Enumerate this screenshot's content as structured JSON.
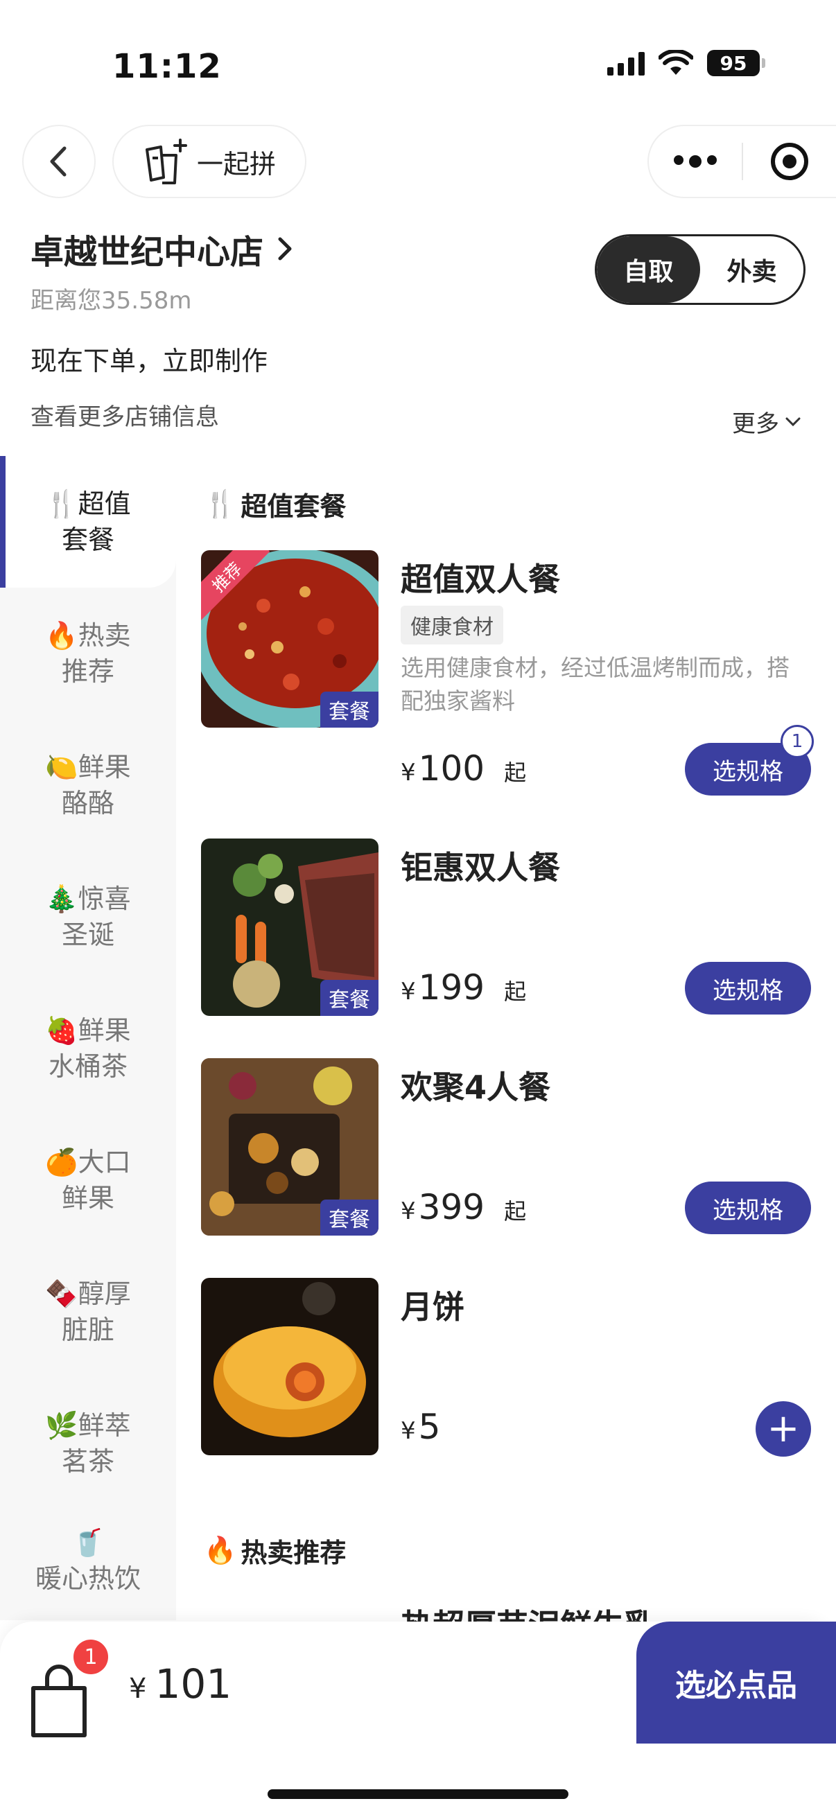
{
  "status": {
    "time": "11:12",
    "battery": "95"
  },
  "nav": {
    "together_label": "一起拼"
  },
  "store": {
    "name": "卓越世纪中心店",
    "distance": "距离您35.58m",
    "order_note": "现在下单，立即制作",
    "more_info": "查看更多店铺信息",
    "more_link": "更多",
    "mode_pickup": "自取",
    "mode_delivery": "外卖",
    "mode_selected": "自取"
  },
  "sidebar": {
    "items": [
      {
        "emoji": "🍴",
        "line1": "超值",
        "line2": "套餐",
        "active": true
      },
      {
        "emoji": "🔥",
        "line1": "热卖",
        "line2": "推荐"
      },
      {
        "emoji": "🍋",
        "line1": "鲜果",
        "line2": "酪酪"
      },
      {
        "emoji": "🎄",
        "line1": "惊喜",
        "line2": "圣诞"
      },
      {
        "emoji": "🍓",
        "line1": "鲜果",
        "line2": "水桶茶"
      },
      {
        "emoji": "🍊",
        "line1": "大口",
        "line2": "鲜果"
      },
      {
        "emoji": "🍫",
        "line1": "醇厚",
        "line2": "脏脏"
      },
      {
        "emoji": "🌿",
        "line1": "鲜萃",
        "line2": "茗茶"
      },
      {
        "emoji": "🥤",
        "line1": "暖心热饮",
        "line2": ""
      }
    ]
  },
  "sections": [
    {
      "emoji": "🍴",
      "title": "超值套餐"
    },
    {
      "emoji": "🔥",
      "title": "热卖推荐"
    }
  ],
  "products": [
    {
      "name": "超值双人餐",
      "chip": "健康食材",
      "desc": "选用健康食材，经过低温烤制而成，搭配独家酱料",
      "currency": "¥",
      "price": "100",
      "suffix": "起",
      "button": "选规格",
      "badge": "1",
      "tag": "套餐",
      "ribbon": "推荐"
    },
    {
      "name": "钜惠双人餐",
      "currency": "¥",
      "price": "199",
      "suffix": "起",
      "button": "选规格",
      "tag": "套餐"
    },
    {
      "name": "欢聚4人餐",
      "currency": "¥",
      "price": "399",
      "suffix": "起",
      "button": "选规格",
      "tag": "套餐"
    },
    {
      "name": "月饼",
      "currency": "¥",
      "price": "5",
      "button": "+"
    },
    {
      "name": "热超厚芋泥鲜牛乳"
    }
  ],
  "cart": {
    "count": "1",
    "currency": "¥",
    "total": "101",
    "checkout_label": "选必点品"
  },
  "colors": {
    "accent": "#3b3fa0",
    "badge_red": "#f04141",
    "ribbon_red": "#e64560"
  }
}
